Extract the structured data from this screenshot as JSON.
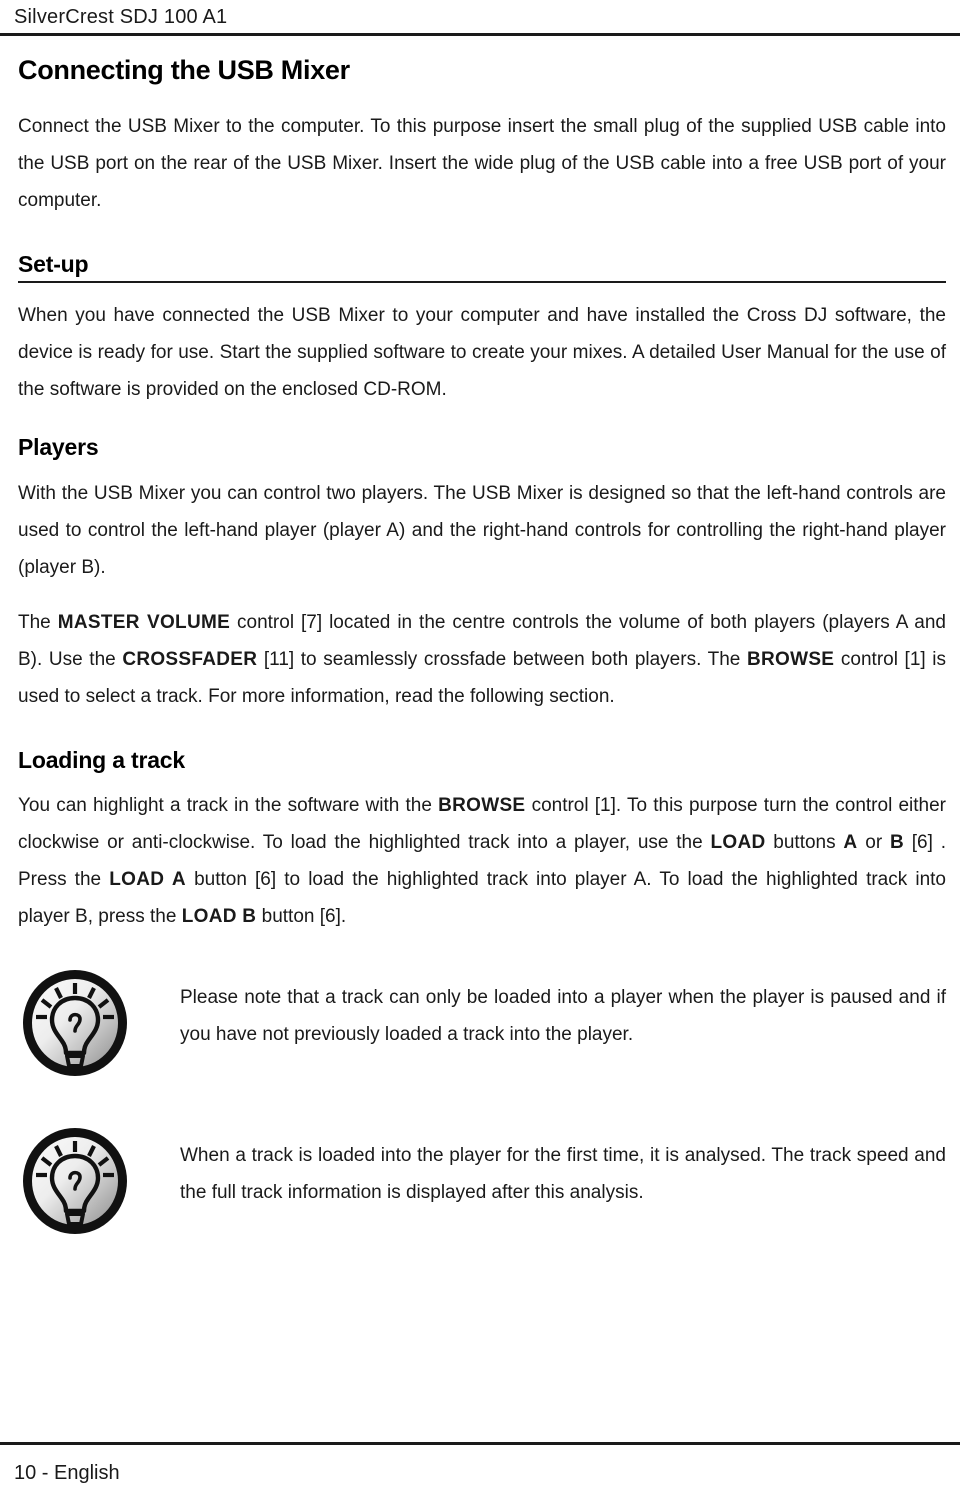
{
  "header": {
    "running_title": "SilverCrest SDJ 100 A1"
  },
  "document": {
    "title": "Connecting the USB Mixer",
    "intro_paragraph": "Connect the USB Mixer to the computer. To this purpose insert the small plug of the supplied USB cable into the USB port on the rear of the USB Mixer. Insert the wide plug of the USB cable into a free USB port of your computer.",
    "sections": [
      {
        "heading": "Set-up",
        "has_rule": true,
        "paragraph": "When you have connected the USB Mixer to your computer and have installed the Cross DJ software, the device is ready for use. Start the supplied software to create your mixes. A detailed User Manual for the use of the software is provided on the enclosed CD-ROM."
      },
      {
        "heading": "Players",
        "has_rule": false,
        "paragraph": "With the USB Mixer you can control two players. The USB Mixer is designed so that the left-hand controls are used to control the left-hand player (player A) and the right-hand controls for controlling the right-hand player (player B)."
      },
      {
        "heading": "Loading a track",
        "has_rule": false
      }
    ],
    "controls_paragraph": {
      "part1": "The ",
      "master_volume": "MASTER VOLUME",
      "part2": " control [7] located in the centre controls the volume of both players (players A and B). Use the ",
      "crossfader": "CROSSFADER",
      "part3": " [11] to seamlessly crossfade between both players. The ",
      "browse": "BROWSE",
      "part4": " control [1] is used to select a track. For more information, read the following section."
    },
    "loading_paragraph": {
      "part1": "You can highlight a track in the software with the ",
      "browse": "BROWSE",
      "part2": " control [1]. To this purpose turn the control either clockwise or anti-clockwise. To load the highlighted track into a player, use the ",
      "load": "LOAD",
      "part3": " buttons ",
      "a": "A",
      "part4": " or ",
      "b": "B",
      "part5": " [6] . Press the ",
      "load_a": "LOAD A",
      "part6": " button [6] to load the highlighted track into player A. To load the highlighted track into player B, press the ",
      "load_b": "LOAD B",
      "part7": " button [6]."
    },
    "notes": [
      {
        "icon": "lightbulb-icon",
        "text": "Please note that a track can only be loaded into a player when the player is paused and if you have not previously loaded a track into the player."
      },
      {
        "icon": "lightbulb-icon",
        "text": "When a track is loaded into the player for the first time, it is analysed. The track speed and the full track information is displayed after this analysis."
      }
    ]
  },
  "footer": {
    "page_label": "10 - English"
  },
  "colors": {
    "text": "#1a1a1a",
    "rule": "#1a1a1a",
    "icon_ring": "#111111",
    "icon_fill_light": "#f2f2f2",
    "icon_fill_dark": "#9a9a9a"
  }
}
